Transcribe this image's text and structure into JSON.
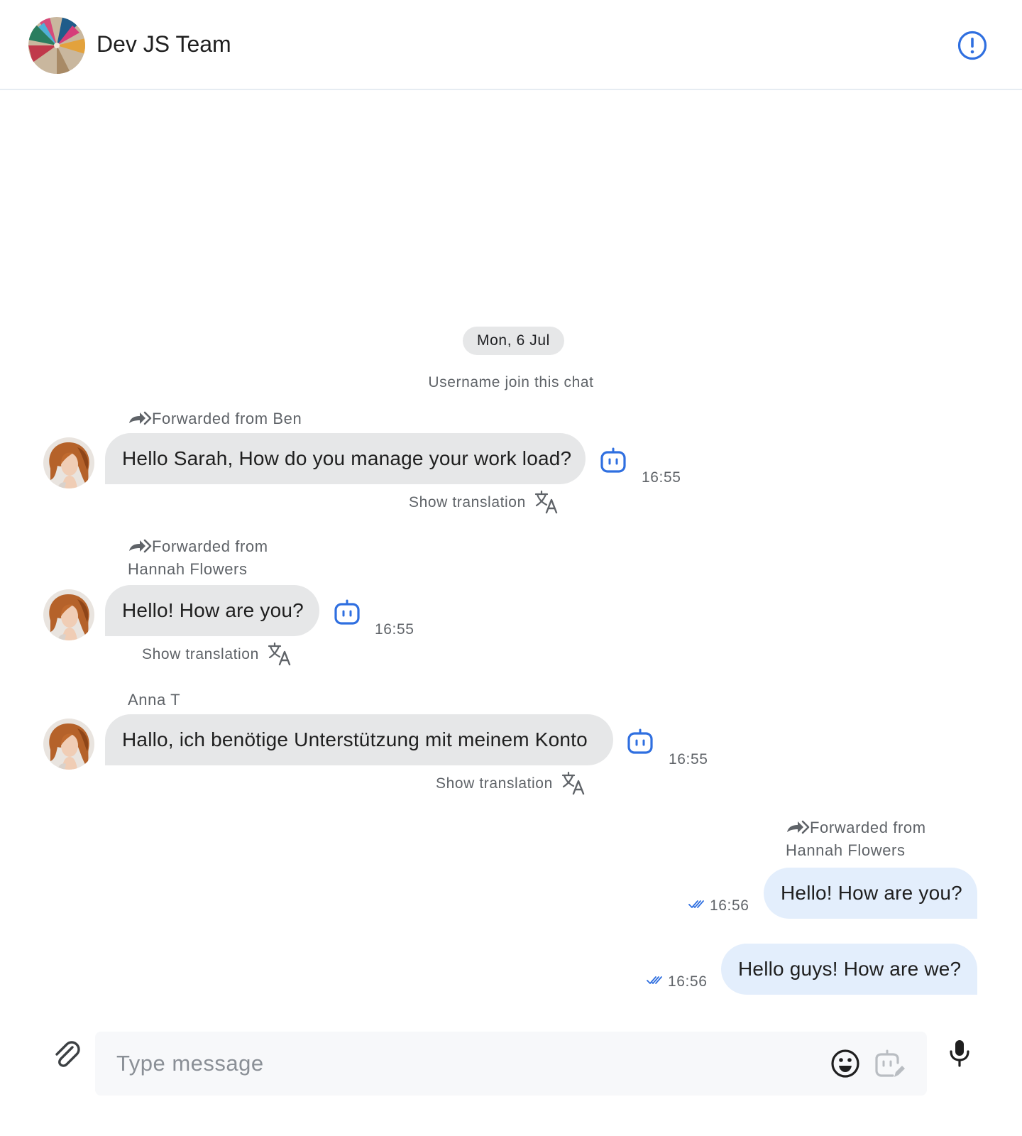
{
  "header": {
    "title": "Dev JS Team",
    "avatar": "group-avatar",
    "info_icon": "info-icon"
  },
  "date_divider": "Mon, 6 Jul",
  "system_message": "Username join this chat",
  "messages": [
    {
      "direction": "incoming",
      "forwarded_label": "Forwarded from Ben",
      "text": "Hello Sarah, How do you manage your work load?",
      "time": "16:55",
      "translation_label": "Show translation"
    },
    {
      "direction": "incoming",
      "forwarded_line1": "Forwarded from",
      "forwarded_line2": "Hannah Flowers",
      "text": "Hello! How are you?",
      "time": "16:55",
      "translation_label": "Show translation"
    },
    {
      "direction": "incoming",
      "sender": "Anna T",
      "text": "Hallo, ich benötige Unterstützung mit meinem Konto",
      "time": "16:55",
      "translation_label": "Show translation"
    },
    {
      "direction": "outgoing",
      "forwarded_line1": "Forwarded from",
      "forwarded_line2": "Hannah Flowers",
      "text": "Hello! How are you?",
      "time": "16:56",
      "status": "read"
    },
    {
      "direction": "outgoing",
      "text": "Hello guys! How are we?",
      "time": "16:56",
      "status": "read"
    }
  ],
  "composer": {
    "placeholder": "Type message"
  },
  "colors": {
    "accent": "#2f6fe0",
    "incoming_bubble": "#e6e7e8",
    "outgoing_bubble": "#e3eefc",
    "muted_text": "#5f6368"
  }
}
